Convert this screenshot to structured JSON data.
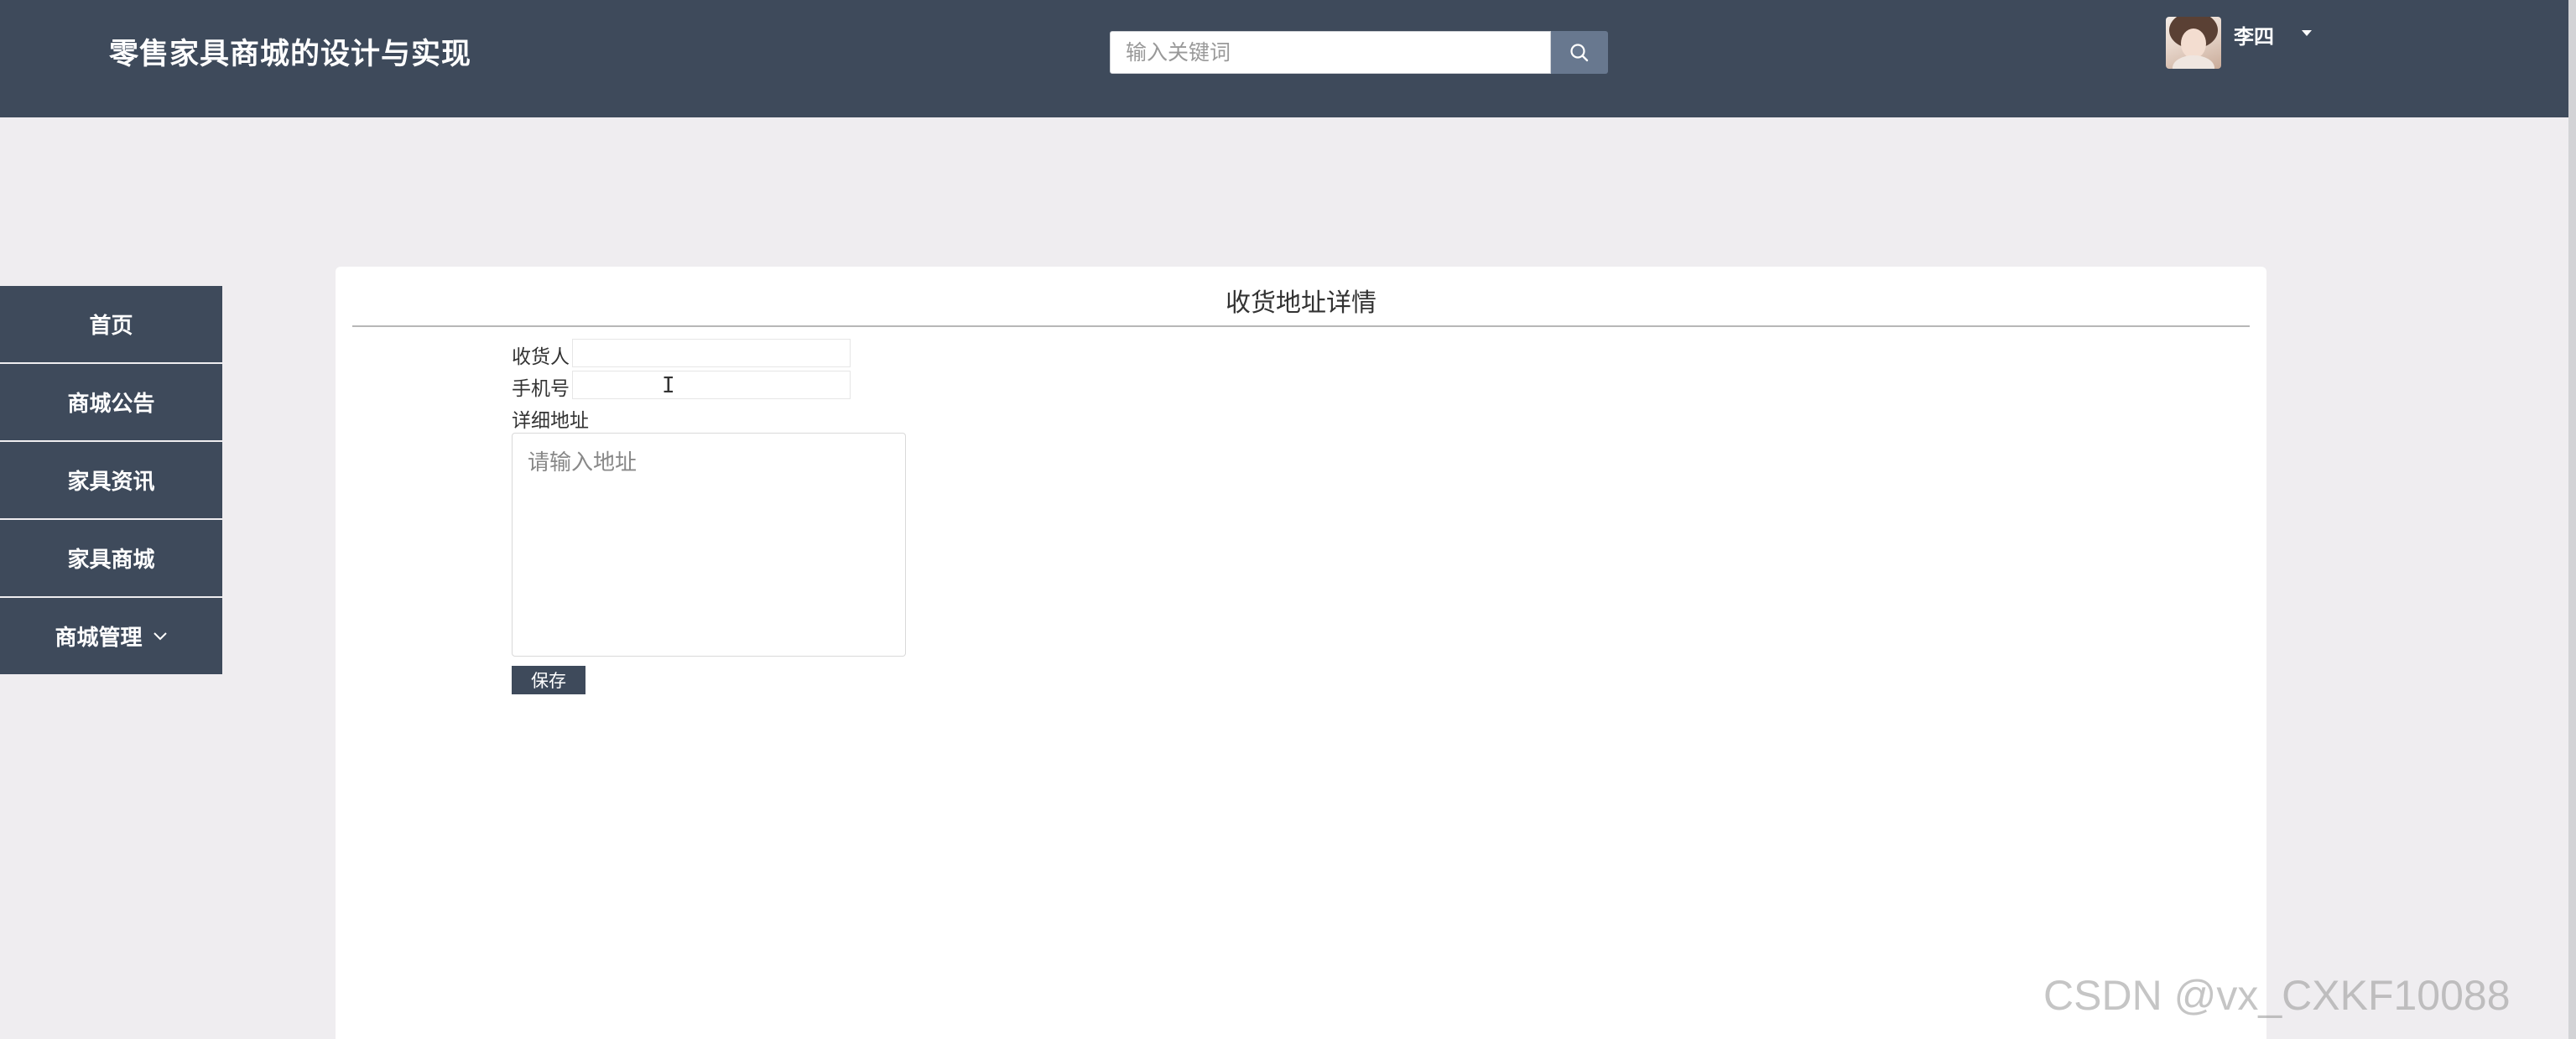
{
  "header": {
    "site_title": "零售家具商城的设计与实现",
    "search": {
      "placeholder": "输入关键词",
      "value": "",
      "button_icon": "search-icon"
    },
    "user": {
      "name": "李四",
      "caret_icon": "caret-down-icon"
    }
  },
  "sidebar": {
    "items": [
      {
        "label": "首页"
      },
      {
        "label": "商城公告"
      },
      {
        "label": "家具资讯"
      },
      {
        "label": "家具商城"
      },
      {
        "label": "商城管理",
        "icon": "chevron-down-icon"
      }
    ]
  },
  "form": {
    "title": "收货地址详情",
    "consignee": {
      "label": "收货人",
      "value": ""
    },
    "phone": {
      "label": "手机号",
      "value": ""
    },
    "address": {
      "label": "详细地址",
      "placeholder": "请输入地址",
      "value": ""
    },
    "save_label": "保存"
  },
  "watermark": "CSDN @vx_CXKF10088",
  "colors": {
    "header_bg": "#3e4a5b",
    "search_button": "#68788f",
    "page_bg": "#efedf0",
    "panel_bg": "#ffffff"
  }
}
